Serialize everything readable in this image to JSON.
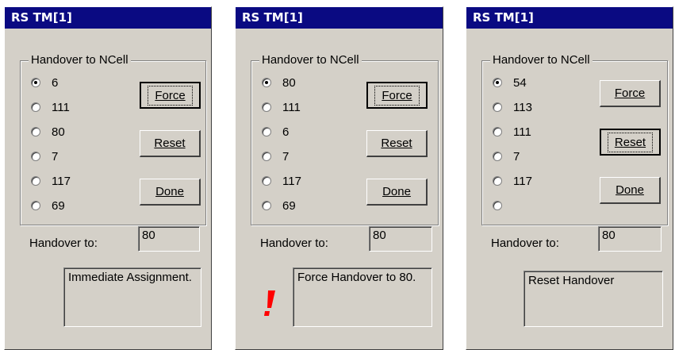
{
  "colors": {
    "title_bar": "#0a0a82",
    "dialog": "#d4d0c8",
    "warning_icon": "#ff0000"
  },
  "windows": [
    {
      "title": "RS TM[1]",
      "group_label": "Handover to NCell",
      "cells": [
        "6",
        "111",
        "80",
        "7",
        "117",
        "69"
      ],
      "selected_index": 0,
      "buttons": {
        "force": "Force",
        "reset": "Reset",
        "done": "Done"
      },
      "default_button": "force",
      "handover_label": "Handover to:",
      "handover_value": "80",
      "status": "Immediate Assignment.",
      "warning_icon": ""
    },
    {
      "title": "RS TM[1]",
      "group_label": "Handover to NCell",
      "cells": [
        "80",
        "111",
        "6",
        "7",
        "117",
        "69"
      ],
      "selected_index": 0,
      "buttons": {
        "force": "Force",
        "reset": "Reset",
        "done": "Done"
      },
      "default_button": "force",
      "handover_label": "Handover to:",
      "handover_value": "80",
      "status": "Force Handover to 80.",
      "warning_icon": "exclamation-icon"
    },
    {
      "title": "RS TM[1]",
      "group_label": "Handover to NCell",
      "cells": [
        "54",
        "113",
        "111",
        "7",
        "117",
        ""
      ],
      "selected_index": 0,
      "buttons": {
        "force": "Force",
        "reset": "Reset",
        "done": "Done"
      },
      "default_button": "reset",
      "handover_label": "Handover to:",
      "handover_value": "80",
      "status": "Reset Handover",
      "warning_icon": ""
    }
  ]
}
